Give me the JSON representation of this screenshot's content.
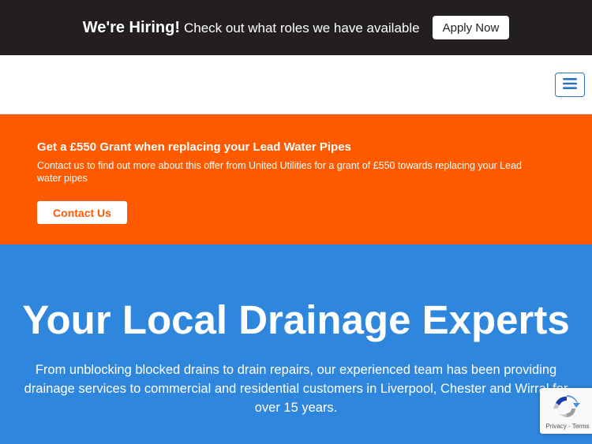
{
  "topbar": {
    "hiring_strong": "We're Hiring!",
    "hiring_rest": "Check out what roles we have available",
    "apply_label": "Apply Now"
  },
  "navbar": {
    "menu_icon": "hamburger-menu-icon"
  },
  "grant": {
    "title": "Get a £550 Grant when replacing your Lead Water Pipes",
    "description": "Contact us to find out more about this offer from United Utilities for a grant of £550 towards replacing your Lead water pipes",
    "contact_label": "Contact Us"
  },
  "hero": {
    "title": "Your Local Drainage Experts",
    "subtitle": "From unblocking blocked drains to drain repairs, our experienced team has been providing drainage services to commercial and residential customers in Liverpool, Chester and Wirral for over 15 years."
  },
  "recaptcha": {
    "icon": "recaptcha-logo-icon",
    "privacy": "Privacy",
    "separator": " - ",
    "terms": "Terms"
  },
  "colors": {
    "topbar_bg": "#231f20",
    "accent_orange": "#ff5a00",
    "hero_blue": "#2f86dd",
    "menu_blue": "#2b73c2"
  }
}
